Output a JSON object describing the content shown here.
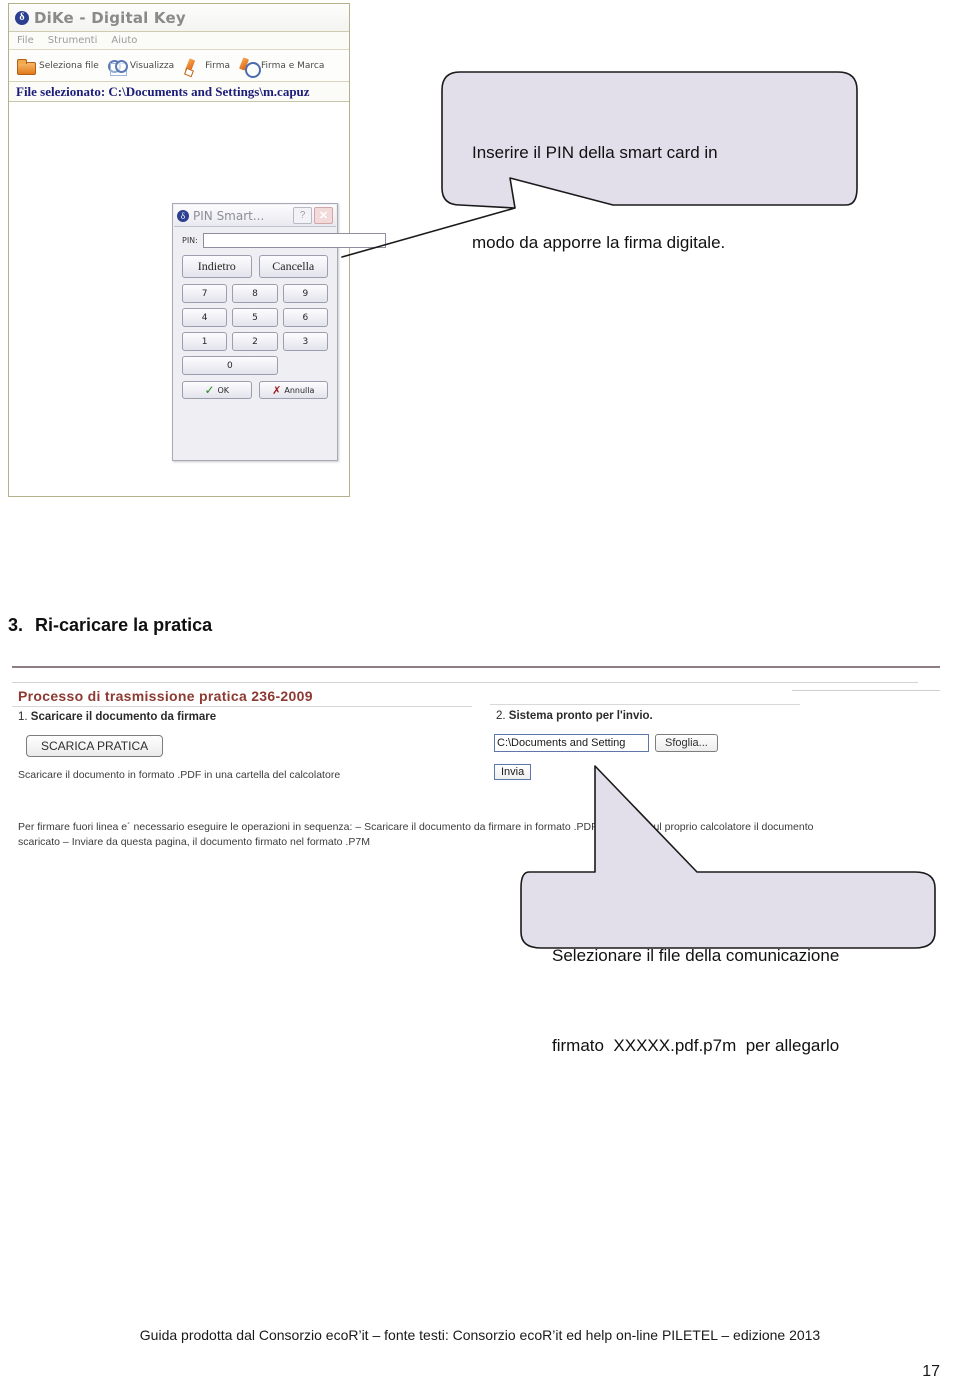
{
  "dike_window": {
    "title": "DiKe - Digital Key",
    "logo_icon": "dike-logo-icon",
    "menus": [
      "File",
      "Strumenti",
      "Aiuto"
    ],
    "toolbar": [
      {
        "label": "Seleziona file",
        "icon": "folder-icon"
      },
      {
        "label": "Visualizza",
        "icon": "glasses-icon"
      },
      {
        "label": "Firma",
        "icon": "pen-icon"
      },
      {
        "label": "Firma e Marca",
        "icon": "pen-clock-icon"
      }
    ],
    "status_bar": "File selezionato: C:\\Documents and Settings\\m.capuz"
  },
  "pin_dialog": {
    "title": "PIN Smart...",
    "logo_icon": "dike-logo-icon",
    "help_label": "?",
    "close_label": "✕",
    "pin_label": "PIN:",
    "pin_value": "",
    "pin_placeholder": "",
    "back_label": "Indietro",
    "clear_label": "Cancella",
    "keys": [
      "7",
      "8",
      "9",
      "4",
      "5",
      "6",
      "1",
      "2",
      "3"
    ],
    "zero_label": "0",
    "ok_label": "OK",
    "cancel_label": "Annulla",
    "ok_icon": "check-icon",
    "cancel_icon": "x-icon"
  },
  "callouts": {
    "pin": {
      "line1": "Inserire il PIN della smart card in",
      "line2": "modo da apporre la firma digitale."
    },
    "file": {
      "line1": "Selezionare il file della comunicazione",
      "line2": "firmato  XXXXX.pdf.p7m  per allegarlo"
    }
  },
  "section": {
    "number": "3.",
    "title": "Ri-caricare la pratica"
  },
  "web_shot": {
    "heading": "Processo di trasmissione pratica 236-2009",
    "step1_num": "1.",
    "step1_text": "Scaricare il documento da firmare",
    "download_button": "SCARICA PRATICA",
    "step1_note": "Scaricare il documento in formato .PDF in una cartella del calcolatore",
    "step2_num": "2.",
    "step2_text": "Sistema pronto per l'invio.",
    "file_value": "C:\\Documents and Setting",
    "browse_button": "Sfoglia...",
    "send_button": "Invia",
    "paragraph_line1": "Per firmare fuori linea e´ necessario eseguire le operazioni in sequenza: – Scaricare il documento da firmare in formato .PDF – Firmare sul proprio calcolatore il documento",
    "paragraph_line2": "scaricato – Inviare da questa pagina, il documento firmato nel formato .P7M"
  },
  "footer": {
    "text": "Guida prodotta dal Consorzio ecoR’it – fonte testi: Consorzio ecoR’it ed help on-line PILETEL – edizione 2013",
    "page_number": "17"
  },
  "colors": {
    "callout_fill": "#e2dfeb",
    "callout_stroke": "#1a1a1a",
    "web_heading": "#8c3a32",
    "status_text": "#1c1c7a",
    "rule": "#8f7d86"
  }
}
